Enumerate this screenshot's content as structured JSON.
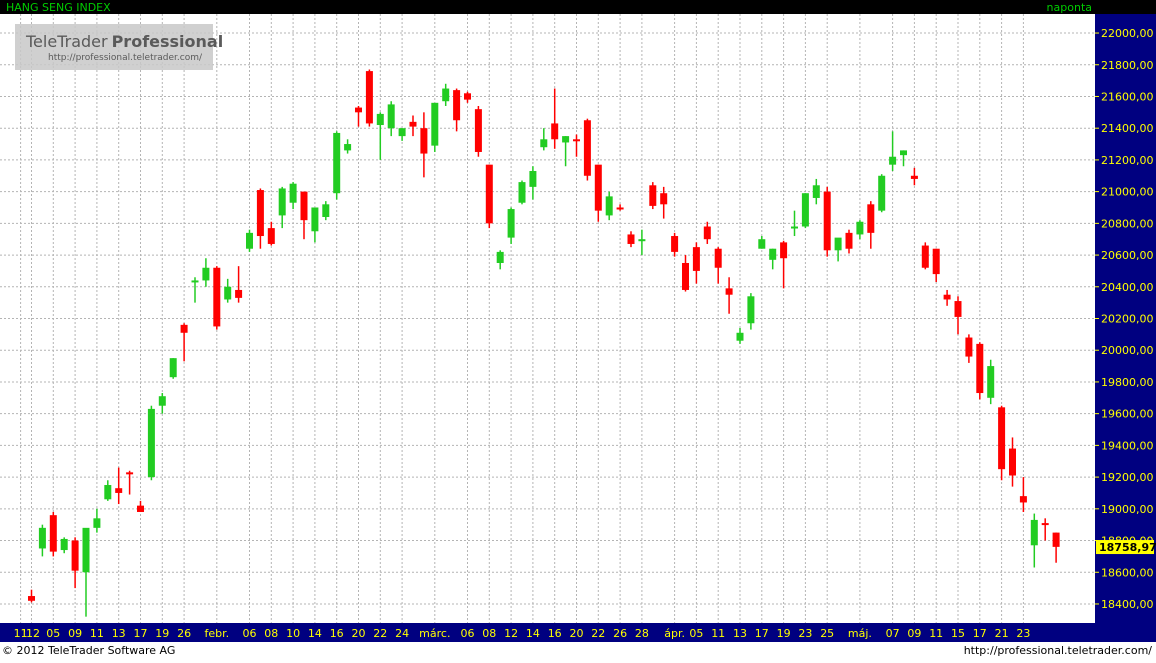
{
  "header": {
    "instrument": "HANG SENG INDEX",
    "period": "naponta"
  },
  "watermark": {
    "brand_light": "TeleTrader",
    "brand_bold": "Professional",
    "url": "http://professional.teletrader.com/"
  },
  "footer": {
    "copyright": "© 2012 TeleTrader Software AG",
    "url": "http://professional.teletrader.com/"
  },
  "colors": {
    "background": "#ffffff",
    "top_bar": "#000000",
    "header_text": "#00cc00",
    "axis_bar": "#000080",
    "axis_text": "#ffff00",
    "up_candle": "#22cc22",
    "down_candle": "#ff0000",
    "grid": "#b4b4b4",
    "last_price_badge": "#ffff00"
  },
  "chart_data": {
    "type": "candlestick",
    "ylim": [
      18280,
      22120
    ],
    "y_ticks": [
      18400,
      18600,
      18800,
      19000,
      19200,
      19400,
      19600,
      19800,
      20000,
      20200,
      20400,
      20600,
      20800,
      21000,
      21200,
      21400,
      21600,
      21800,
      22000
    ],
    "y_tick_labels": [
      "18400,00",
      "18600,00",
      "18800,00",
      "19000,00",
      "19200,00",
      "19400,00",
      "19600,00",
      "19800,00",
      "20000,00",
      "20200,00",
      "20400,00",
      "20600,00",
      "20800,00",
      "21000,00",
      "21200,00",
      "21400,00",
      "21600,00",
      "21800,00",
      "22000,00"
    ],
    "x_labels": [
      {
        "i": -1,
        "label": "11"
      },
      {
        "i": 0,
        "label": "'12"
      },
      {
        "i": 2,
        "label": "05"
      },
      {
        "i": 4,
        "label": "09"
      },
      {
        "i": 6,
        "label": "11"
      },
      {
        "i": 8,
        "label": "13"
      },
      {
        "i": 10,
        "label": "17"
      },
      {
        "i": 12,
        "label": "19"
      },
      {
        "i": 14,
        "label": "26"
      },
      {
        "i": 17,
        "label": "febr."
      },
      {
        "i": 20,
        "label": "06"
      },
      {
        "i": 22,
        "label": "08"
      },
      {
        "i": 24,
        "label": "10"
      },
      {
        "i": 26,
        "label": "14"
      },
      {
        "i": 28,
        "label": "16"
      },
      {
        "i": 30,
        "label": "20"
      },
      {
        "i": 32,
        "label": "22"
      },
      {
        "i": 34,
        "label": "24"
      },
      {
        "i": 37,
        "label": "márc."
      },
      {
        "i": 40,
        "label": "06"
      },
      {
        "i": 42,
        "label": "08"
      },
      {
        "i": 44,
        "label": "12"
      },
      {
        "i": 46,
        "label": "14"
      },
      {
        "i": 48,
        "label": "16"
      },
      {
        "i": 50,
        "label": "20"
      },
      {
        "i": 52,
        "label": "22"
      },
      {
        "i": 54,
        "label": "26"
      },
      {
        "i": 56,
        "label": "28"
      },
      {
        "i": 59,
        "label": "ápr."
      },
      {
        "i": 61,
        "label": "05"
      },
      {
        "i": 63,
        "label": "11"
      },
      {
        "i": 65,
        "label": "13"
      },
      {
        "i": 67,
        "label": "17"
      },
      {
        "i": 69,
        "label": "19"
      },
      {
        "i": 71,
        "label": "23"
      },
      {
        "i": 73,
        "label": "25"
      },
      {
        "i": 76,
        "label": "máj."
      },
      {
        "i": 79,
        "label": "07"
      },
      {
        "i": 81,
        "label": "09"
      },
      {
        "i": 83,
        "label": "11"
      },
      {
        "i": 85,
        "label": "15"
      },
      {
        "i": 87,
        "label": "17"
      },
      {
        "i": 89,
        "label": "21"
      },
      {
        "i": 91,
        "label": "23"
      }
    ],
    "last_price": 18758.97,
    "last_price_label": "18758,97",
    "candles": [
      [
        18450,
        18490,
        18410,
        18420
      ],
      [
        18750,
        18900,
        18700,
        18880
      ],
      [
        18960,
        18980,
        18700,
        18730
      ],
      [
        18740,
        18820,
        18720,
        18810
      ],
      [
        18800,
        18820,
        18500,
        18610
      ],
      [
        18600,
        18860,
        18320,
        18880
      ],
      [
        18880,
        19000,
        18850,
        18940
      ],
      [
        19060,
        19180,
        19050,
        19150
      ],
      [
        19130,
        19260,
        19030,
        19100
      ],
      [
        19230,
        19240,
        19090,
        19220
      ],
      [
        19020,
        19050,
        18980,
        18980
      ],
      [
        19200,
        19650,
        19180,
        19630
      ],
      [
        19650,
        19730,
        19600,
        19710
      ],
      [
        19830,
        19950,
        19820,
        19950
      ],
      [
        20160,
        20170,
        19930,
        20110
      ],
      [
        20440,
        20460,
        20300,
        20440
      ],
      [
        20440,
        20580,
        20400,
        20520
      ],
      [
        20520,
        20530,
        20130,
        20150
      ],
      [
        20320,
        20450,
        20300,
        20400
      ],
      [
        20380,
        20530,
        20300,
        20330
      ],
      [
        20640,
        20760,
        20620,
        20740
      ],
      [
        21010,
        21020,
        20640,
        20720
      ],
      [
        20770,
        20810,
        20660,
        20670
      ],
      [
        20850,
        21030,
        20770,
        21020
      ],
      [
        20930,
        21060,
        20890,
        21050
      ],
      [
        21000,
        21000,
        20700,
        20820
      ],
      [
        20750,
        20900,
        20680,
        20900
      ],
      [
        20840,
        20940,
        20820,
        20920
      ],
      [
        20990,
        21380,
        20950,
        21370
      ],
      [
        21260,
        21330,
        21240,
        21300
      ],
      [
        21530,
        21540,
        21410,
        21500
      ],
      [
        21760,
        21770,
        21410,
        21430
      ],
      [
        21420,
        21500,
        21200,
        21490
      ],
      [
        21400,
        21570,
        21350,
        21550
      ],
      [
        21350,
        21400,
        21320,
        21400
      ],
      [
        21440,
        21480,
        21350,
        21410
      ],
      [
        21400,
        21500,
        21090,
        21240
      ],
      [
        21290,
        21400,
        21250,
        21560
      ],
      [
        21570,
        21680,
        21540,
        21650
      ],
      [
        21640,
        21650,
        21380,
        21450
      ],
      [
        21620,
        21630,
        21560,
        21580
      ],
      [
        21520,
        21540,
        21220,
        21250
      ],
      [
        21170,
        21170,
        20770,
        20800
      ],
      [
        20550,
        20630,
        20510,
        20620
      ],
      [
        20710,
        20900,
        20670,
        20890
      ],
      [
        20930,
        21070,
        20920,
        21060
      ],
      [
        21030,
        21160,
        20950,
        21130
      ],
      [
        21280,
        21400,
        21260,
        21330
      ],
      [
        21430,
        21650,
        21270,
        21330
      ],
      [
        21310,
        21350,
        21160,
        21350
      ],
      [
        21330,
        21360,
        21220,
        21320
      ],
      [
        21450,
        21460,
        21070,
        21100
      ],
      [
        21170,
        21170,
        20810,
        20880
      ],
      [
        20850,
        21000,
        20820,
        20970
      ],
      [
        20900,
        20920,
        20880,
        20890
      ],
      [
        20730,
        20750,
        20650,
        20670
      ],
      [
        20700,
        20760,
        20600,
        20700
      ],
      [
        21040,
        21060,
        20890,
        20910
      ],
      [
        20990,
        21030,
        20830,
        20920
      ],
      [
        20720,
        20740,
        20590,
        20620
      ],
      [
        20550,
        20600,
        20370,
        20380
      ],
      [
        20650,
        20680,
        20420,
        20500
      ],
      [
        20780,
        20810,
        20670,
        20700
      ],
      [
        20640,
        20650,
        20420,
        20520
      ],
      [
        20390,
        20460,
        20230,
        20350
      ],
      [
        20060,
        20140,
        20040,
        20110
      ],
      [
        20170,
        20360,
        20130,
        20340
      ],
      [
        20640,
        20720,
        20640,
        20700
      ],
      [
        20570,
        20640,
        20510,
        20640
      ],
      [
        20680,
        20690,
        20390,
        20580
      ],
      [
        20780,
        20880,
        20720,
        20780
      ],
      [
        20780,
        20990,
        20770,
        20990
      ],
      [
        20960,
        21080,
        20920,
        21040
      ],
      [
        21000,
        21030,
        20590,
        20630
      ],
      [
        20630,
        20700,
        20560,
        20710
      ],
      [
        20740,
        20760,
        20610,
        20640
      ],
      [
        20730,
        20820,
        20700,
        20810
      ],
      [
        20920,
        20940,
        20640,
        20740
      ],
      [
        20880,
        21110,
        20870,
        21100
      ],
      [
        21170,
        21380,
        21130,
        21220
      ],
      [
        21230,
        21260,
        21160,
        21260
      ],
      [
        21100,
        21150,
        21040,
        21080
      ],
      [
        20660,
        20680,
        20510,
        20520
      ],
      [
        20640,
        20640,
        20430,
        20480
      ],
      [
        20350,
        20380,
        20280,
        20320
      ],
      [
        20310,
        20340,
        20100,
        20210
      ],
      [
        20080,
        20100,
        19920,
        19960
      ],
      [
        20040,
        20050,
        19690,
        19730
      ],
      [
        19700,
        19940,
        19660,
        19900
      ],
      [
        19640,
        19650,
        19180,
        19250
      ],
      [
        19380,
        19450,
        19140,
        19210
      ],
      [
        19080,
        19200,
        18980,
        19040
      ],
      [
        18770,
        18970,
        18630,
        18930
      ],
      [
        18910,
        18940,
        18800,
        18900
      ],
      [
        18850,
        18850,
        18660,
        18760
      ]
    ]
  }
}
